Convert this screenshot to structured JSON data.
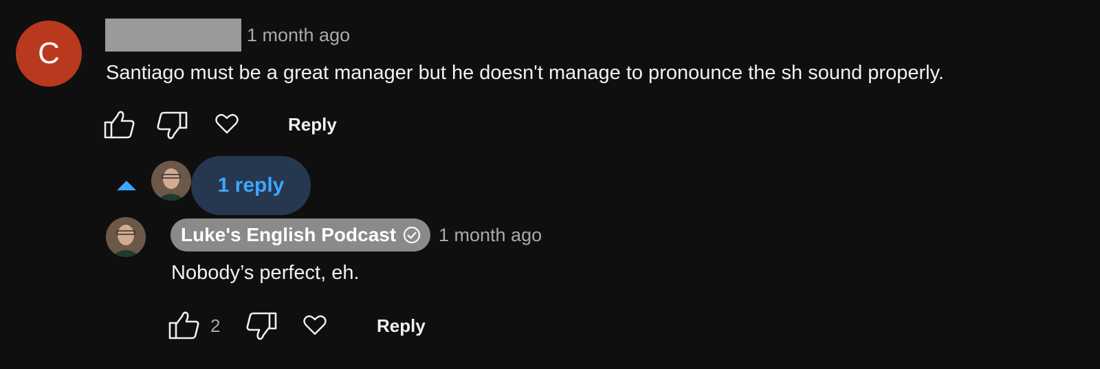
{
  "comment": {
    "avatar_letter": "C",
    "avatar_color": "#b9391e",
    "timestamp": "1 month ago",
    "text": "Santiago must be a great manager but he doesn't manage to pronounce the sh sound properly.",
    "actions": {
      "like_icon": "thumbs-up-icon",
      "dislike_icon": "thumbs-down-icon",
      "heart_icon": "heart-icon",
      "reply_label": "Reply"
    },
    "replies_toggle": {
      "label": "1 reply",
      "icon": "caret-up-icon",
      "pill_color": "#263850",
      "text_color": "#3ea6ff"
    }
  },
  "reply": {
    "author": "Luke's English Podcast",
    "author_badge_color": "#8a8a8a",
    "verified_icon": "verified-check-icon",
    "timestamp": "1 month ago",
    "text": "Nobody’s perfect, eh.",
    "like_count": "2",
    "actions": {
      "like_icon": "thumbs-up-icon",
      "dislike_icon": "thumbs-down-icon",
      "heart_icon": "heart-icon",
      "reply_label": "Reply"
    }
  }
}
